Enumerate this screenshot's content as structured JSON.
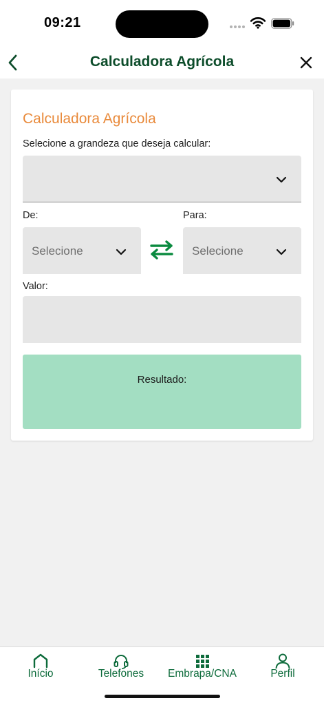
{
  "status": {
    "time": "09:21"
  },
  "nav": {
    "title": "Calculadora Agrícola"
  },
  "card": {
    "title": "Calculadora Agrícola",
    "quantity_label": "Selecione a grandeza que deseja calcular:",
    "quantity_selected": "",
    "from_label": "De:",
    "from_placeholder": "Selecione",
    "to_label": "Para:",
    "to_placeholder": "Selecione",
    "value_label": "Valor:",
    "value": "",
    "result_label": "Resultado:"
  },
  "tabs": [
    {
      "label": "Início",
      "icon": "home-icon"
    },
    {
      "label": "Telefones",
      "icon": "headset-icon"
    },
    {
      "label": "Embrapa/CNA",
      "icon": "grid-icon"
    },
    {
      "label": "Perfil",
      "icon": "person-icon"
    }
  ],
  "colors": {
    "brand_green": "#0d4d2b",
    "accent_orange": "#e98a3b",
    "tab_green": "#0d6b3b",
    "result_bg": "#a3dec2",
    "swap_green": "#0a8a3f"
  }
}
